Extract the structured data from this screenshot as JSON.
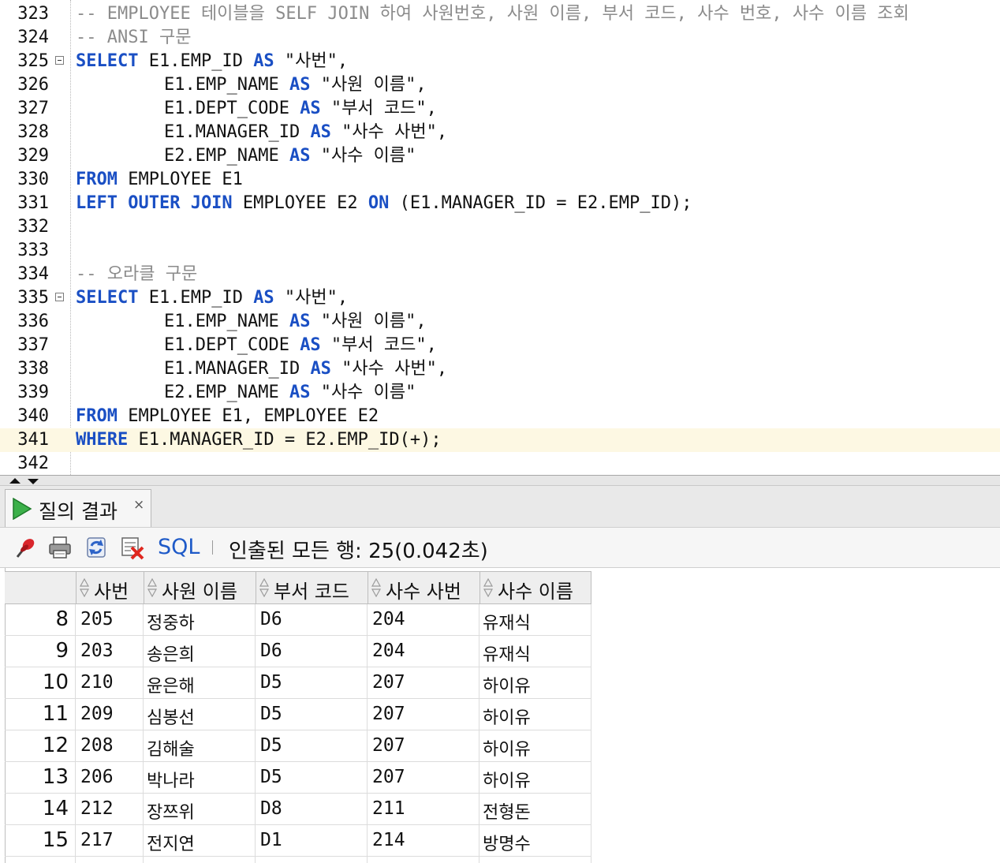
{
  "editor": {
    "lines": [
      {
        "no": "323",
        "fold": false,
        "current": false,
        "indent": 0,
        "tokens": [
          {
            "t": "cm",
            "v": "-- EMPLOYEE 테이블을 SELF JOIN 하여 사원번호, 사원 이름, 부서 코드, 사수 번호, 사수 이름 조회"
          }
        ]
      },
      {
        "no": "324",
        "fold": false,
        "current": false,
        "indent": 0,
        "tokens": [
          {
            "t": "cm",
            "v": "-- ANSI 구문"
          }
        ]
      },
      {
        "no": "325",
        "fold": true,
        "current": false,
        "indent": 0,
        "tokens": [
          {
            "t": "kw",
            "v": "SELECT"
          },
          {
            "t": "plain",
            "v": " E1.EMP_ID "
          },
          {
            "t": "kw",
            "v": "AS"
          },
          {
            "t": "plain",
            "v": " \"사번\","
          }
        ]
      },
      {
        "no": "326",
        "fold": false,
        "current": false,
        "indent": 1,
        "tokens": [
          {
            "t": "plain",
            "v": "E1.EMP_NAME "
          },
          {
            "t": "kw",
            "v": "AS"
          },
          {
            "t": "plain",
            "v": " \"사원 이름\","
          }
        ]
      },
      {
        "no": "327",
        "fold": false,
        "current": false,
        "indent": 1,
        "tokens": [
          {
            "t": "plain",
            "v": "E1.DEPT_CODE "
          },
          {
            "t": "kw",
            "v": "AS"
          },
          {
            "t": "plain",
            "v": " \"부서 코드\","
          }
        ]
      },
      {
        "no": "328",
        "fold": false,
        "current": false,
        "indent": 1,
        "tokens": [
          {
            "t": "plain",
            "v": "E1.MANAGER_ID "
          },
          {
            "t": "kw",
            "v": "AS"
          },
          {
            "t": "plain",
            "v": " \"사수 사번\","
          }
        ]
      },
      {
        "no": "329",
        "fold": false,
        "current": false,
        "indent": 1,
        "tokens": [
          {
            "t": "plain",
            "v": "E2.EMP_NAME "
          },
          {
            "t": "kw",
            "v": "AS"
          },
          {
            "t": "plain",
            "v": " \"사수 이름\""
          }
        ]
      },
      {
        "no": "330",
        "fold": false,
        "current": false,
        "indent": 0,
        "tokens": [
          {
            "t": "kw",
            "v": "FROM"
          },
          {
            "t": "plain",
            "v": " EMPLOYEE E1"
          }
        ]
      },
      {
        "no": "331",
        "fold": false,
        "current": false,
        "indent": 0,
        "tokens": [
          {
            "t": "kw",
            "v": "LEFT OUTER JOIN"
          },
          {
            "t": "plain",
            "v": " EMPLOYEE E2 "
          },
          {
            "t": "kw",
            "v": "ON"
          },
          {
            "t": "plain",
            "v": " (E1.MANAGER_ID = E2.EMP_ID);"
          }
        ]
      },
      {
        "no": "332",
        "fold": false,
        "current": false,
        "indent": 0,
        "tokens": []
      },
      {
        "no": "333",
        "fold": false,
        "current": false,
        "indent": 0,
        "tokens": []
      },
      {
        "no": "334",
        "fold": false,
        "current": false,
        "indent": 0,
        "tokens": [
          {
            "t": "cm",
            "v": "-- 오라클 구문"
          }
        ]
      },
      {
        "no": "335",
        "fold": true,
        "current": false,
        "indent": 0,
        "tokens": [
          {
            "t": "kw",
            "v": "SELECT"
          },
          {
            "t": "plain",
            "v": " E1.EMP_ID "
          },
          {
            "t": "kw",
            "v": "AS"
          },
          {
            "t": "plain",
            "v": " \"사번\","
          }
        ]
      },
      {
        "no": "336",
        "fold": false,
        "current": false,
        "indent": 1,
        "tokens": [
          {
            "t": "plain",
            "v": "E1.EMP_NAME "
          },
          {
            "t": "kw",
            "v": "AS"
          },
          {
            "t": "plain",
            "v": " \"사원 이름\","
          }
        ]
      },
      {
        "no": "337",
        "fold": false,
        "current": false,
        "indent": 1,
        "tokens": [
          {
            "t": "plain",
            "v": "E1.DEPT_CODE "
          },
          {
            "t": "kw",
            "v": "AS"
          },
          {
            "t": "plain",
            "v": " \"부서 코드\","
          }
        ]
      },
      {
        "no": "338",
        "fold": false,
        "current": false,
        "indent": 1,
        "tokens": [
          {
            "t": "plain",
            "v": "E1.MANAGER_ID "
          },
          {
            "t": "kw",
            "v": "AS"
          },
          {
            "t": "plain",
            "v": " \"사수 사번\","
          }
        ]
      },
      {
        "no": "339",
        "fold": false,
        "current": false,
        "indent": 1,
        "tokens": [
          {
            "t": "plain",
            "v": "E2.EMP_NAME "
          },
          {
            "t": "kw",
            "v": "AS"
          },
          {
            "t": "plain",
            "v": " \"사수 이름\""
          }
        ]
      },
      {
        "no": "340",
        "fold": false,
        "current": false,
        "indent": 0,
        "tokens": [
          {
            "t": "kw",
            "v": "FROM"
          },
          {
            "t": "plain",
            "v": " EMPLOYEE E1, EMPLOYEE E2"
          }
        ]
      },
      {
        "no": "341",
        "fold": false,
        "current": true,
        "indent": 0,
        "tokens": [
          {
            "t": "kw",
            "v": "WHERE"
          },
          {
            "t": "plain",
            "v": " E1.MANAGER_ID = E2.EMP_ID(+);"
          }
        ]
      },
      {
        "no": "342",
        "fold": false,
        "current": false,
        "indent": 0,
        "tokens": []
      }
    ]
  },
  "results": {
    "tab_title": "질의 결과",
    "tab_close": "×",
    "toolbar": {
      "sql_label": "SQL",
      "status": "인출된 모든 행: 25(0.042초)",
      "icons": [
        "pin-icon",
        "print-icon",
        "refresh-icon",
        "delete-icon"
      ]
    },
    "columns": [
      "사번",
      "사원 이름",
      "부서 코드",
      "사수 사번",
      "사수 이름"
    ],
    "rows": [
      {
        "rn": "8",
        "cells": [
          "205",
          "정중하",
          "D6",
          "204",
          "유재식"
        ]
      },
      {
        "rn": "9",
        "cells": [
          "203",
          "송은희",
          "D6",
          "204",
          "유재식"
        ]
      },
      {
        "rn": "10",
        "cells": [
          "210",
          "윤은해",
          "D5",
          "207",
          "하이유"
        ]
      },
      {
        "rn": "11",
        "cells": [
          "209",
          "심봉선",
          "D5",
          "207",
          "하이유"
        ]
      },
      {
        "rn": "12",
        "cells": [
          "208",
          "김해술",
          "D5",
          "207",
          "하이유"
        ]
      },
      {
        "rn": "13",
        "cells": [
          "206",
          "박나라",
          "D5",
          "207",
          "하이유"
        ]
      },
      {
        "rn": "14",
        "cells": [
          "212",
          "장쯔위",
          "D8",
          "211",
          "전형돈"
        ]
      },
      {
        "rn": "15",
        "cells": [
          "217",
          "전지연",
          "D1",
          "214",
          "방명수"
        ]
      },
      {
        "rn": "",
        "cells": [
          "",
          "",
          "",
          "",
          ""
        ]
      }
    ]
  },
  "colors": {
    "keyword": "#1a4fc4",
    "comment": "#8b8b8b",
    "current_line": "#fdf8e3",
    "sql_link": "#1e5ac8"
  }
}
